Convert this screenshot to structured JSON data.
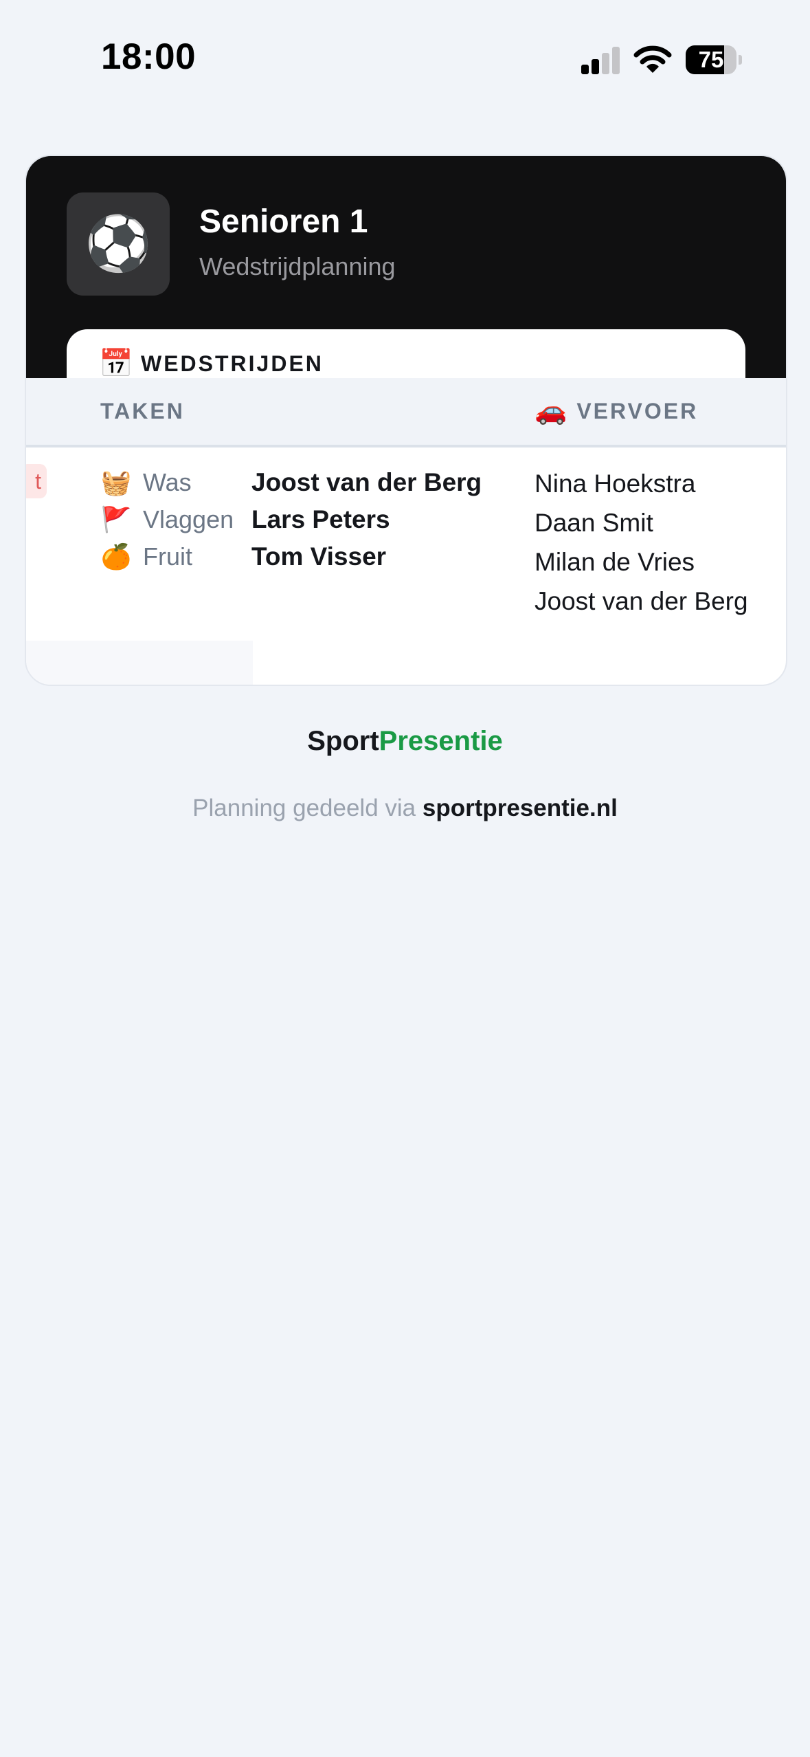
{
  "status_bar": {
    "time": "18:00",
    "battery_percent": 75,
    "battery_label": "75",
    "icons": [
      "signal-icon",
      "wifi-icon",
      "battery-icon"
    ]
  },
  "team": {
    "logo_glyph": "⚽",
    "name": "Senioren 1",
    "subtitle": "Wedstrijdplanning"
  },
  "section": {
    "icon": "📅",
    "label": "WEDSTRIJDEN"
  },
  "table": {
    "tasks_header": "TAKEN",
    "transport_icon": "🚗",
    "transport_header": "VERVOER",
    "status_fragment": "t",
    "tasks": [
      {
        "icon": "🧺",
        "label": "Was",
        "person": "Joost van der Berg"
      },
      {
        "icon": "🚩",
        "label": "Vlaggen",
        "person": "Lars Peters"
      },
      {
        "icon": "🍊",
        "label": "Fruit",
        "person": "Tom Visser"
      }
    ],
    "transport": [
      "Nina Hoekstra",
      "Daan Smit",
      "Milan de Vries",
      "Joost van der Berg"
    ]
  },
  "footer": {
    "brand_part1": "Sport",
    "brand_part2": "Presentie",
    "shared_text": "Planning gedeeld via ",
    "shared_link": "sportpresentie.nl"
  },
  "colors": {
    "brand_green": "#1a9a45",
    "header_dark": "#101011",
    "page_bg": "#f1f4f9"
  }
}
